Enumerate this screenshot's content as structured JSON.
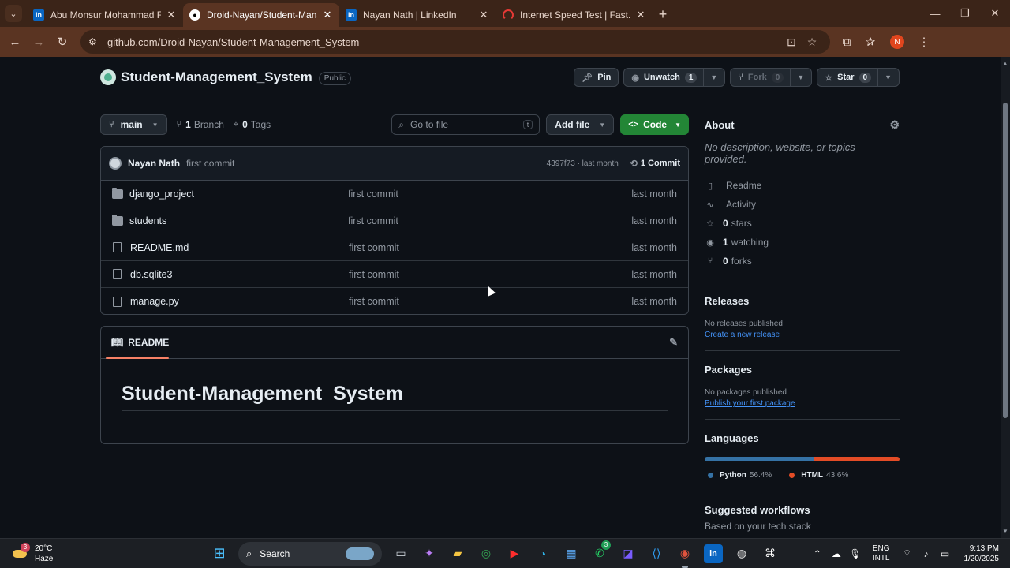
{
  "browser": {
    "tabs": [
      {
        "label": "Abu Monsur Mohammad Fahim",
        "favicon": "linkedin-icon",
        "active": false
      },
      {
        "label": "Droid-Nayan/Student-Management",
        "favicon": "github-icon",
        "active": true
      },
      {
        "label": "Nayan Nath | LinkedIn",
        "favicon": "linkedin-icon",
        "active": false
      },
      {
        "label": "Internet Speed Test | Fast.com",
        "favicon": "fast-icon",
        "active": false
      }
    ],
    "url": "github.com/Droid-Nayan/Student-Management_System",
    "profile_initial": "N"
  },
  "repo": {
    "name": "Student-Management_System",
    "visibility": "Public",
    "actions": {
      "pin_label": "Pin",
      "unwatch_label": "Unwatch",
      "unwatch_count": "1",
      "fork_label": "Fork",
      "fork_count": "0",
      "star_label": "Star",
      "star_count": "0"
    }
  },
  "branchbar": {
    "branch": "main",
    "branch_count": "1",
    "branch_label": "Branch",
    "tag_count": "0",
    "tag_label": "Tags",
    "goto_placeholder": "Go to file",
    "goto_shortcut": "t",
    "add_file_label": "Add file",
    "code_label": "Code"
  },
  "commit": {
    "author": "Nayan Nath",
    "message": "first commit",
    "sha_time": "4397f73 · last month",
    "commits_label": "1 Commit"
  },
  "files": [
    {
      "name": "django_project",
      "type": "folder",
      "message": "first commit",
      "date": "last month"
    },
    {
      "name": "students",
      "type": "folder",
      "message": "first commit",
      "date": "last month"
    },
    {
      "name": "README.md",
      "type": "file",
      "message": "first commit",
      "date": "last month"
    },
    {
      "name": "db.sqlite3",
      "type": "file",
      "message": "first commit",
      "date": "last month"
    },
    {
      "name": "manage.py",
      "type": "file",
      "message": "first commit",
      "date": "last month"
    }
  ],
  "readme": {
    "tab_label": "README",
    "title": "Student-Management_System"
  },
  "about": {
    "heading": "About",
    "description": "No description, website, or topics provided.",
    "items": [
      {
        "icon": "book-icon",
        "count": "",
        "label": "Readme"
      },
      {
        "icon": "pulse-icon",
        "count": "",
        "label": "Activity"
      },
      {
        "icon": "star-icon",
        "count": "0",
        "label": "stars"
      },
      {
        "icon": "eye-icon",
        "count": "1",
        "label": "watching"
      },
      {
        "icon": "fork-icon",
        "count": "0",
        "label": "forks"
      }
    ]
  },
  "releases": {
    "heading": "Releases",
    "empty": "No releases published",
    "link": "Create a new release"
  },
  "packages": {
    "heading": "Packages",
    "empty": "No packages published",
    "link": "Publish your first package"
  },
  "languages": {
    "heading": "Languages",
    "items": [
      {
        "name": "Python",
        "percent": "56.4%",
        "value": 56.4,
        "color": "#3572A5"
      },
      {
        "name": "HTML",
        "percent": "43.6%",
        "value": 43.6,
        "color": "#e34c26"
      }
    ]
  },
  "workflows": {
    "heading": "Suggested workflows",
    "sub": "Based on your tech stack"
  },
  "taskbar": {
    "weather_temp": "20°C",
    "weather_desc": "Haze",
    "weather_badge": "3",
    "search_label": "Search",
    "whatsapp_badge": "3",
    "lang_top": "ENG",
    "lang_bottom": "INTL",
    "time": "9:13 PM",
    "date": "1/20/2025"
  }
}
